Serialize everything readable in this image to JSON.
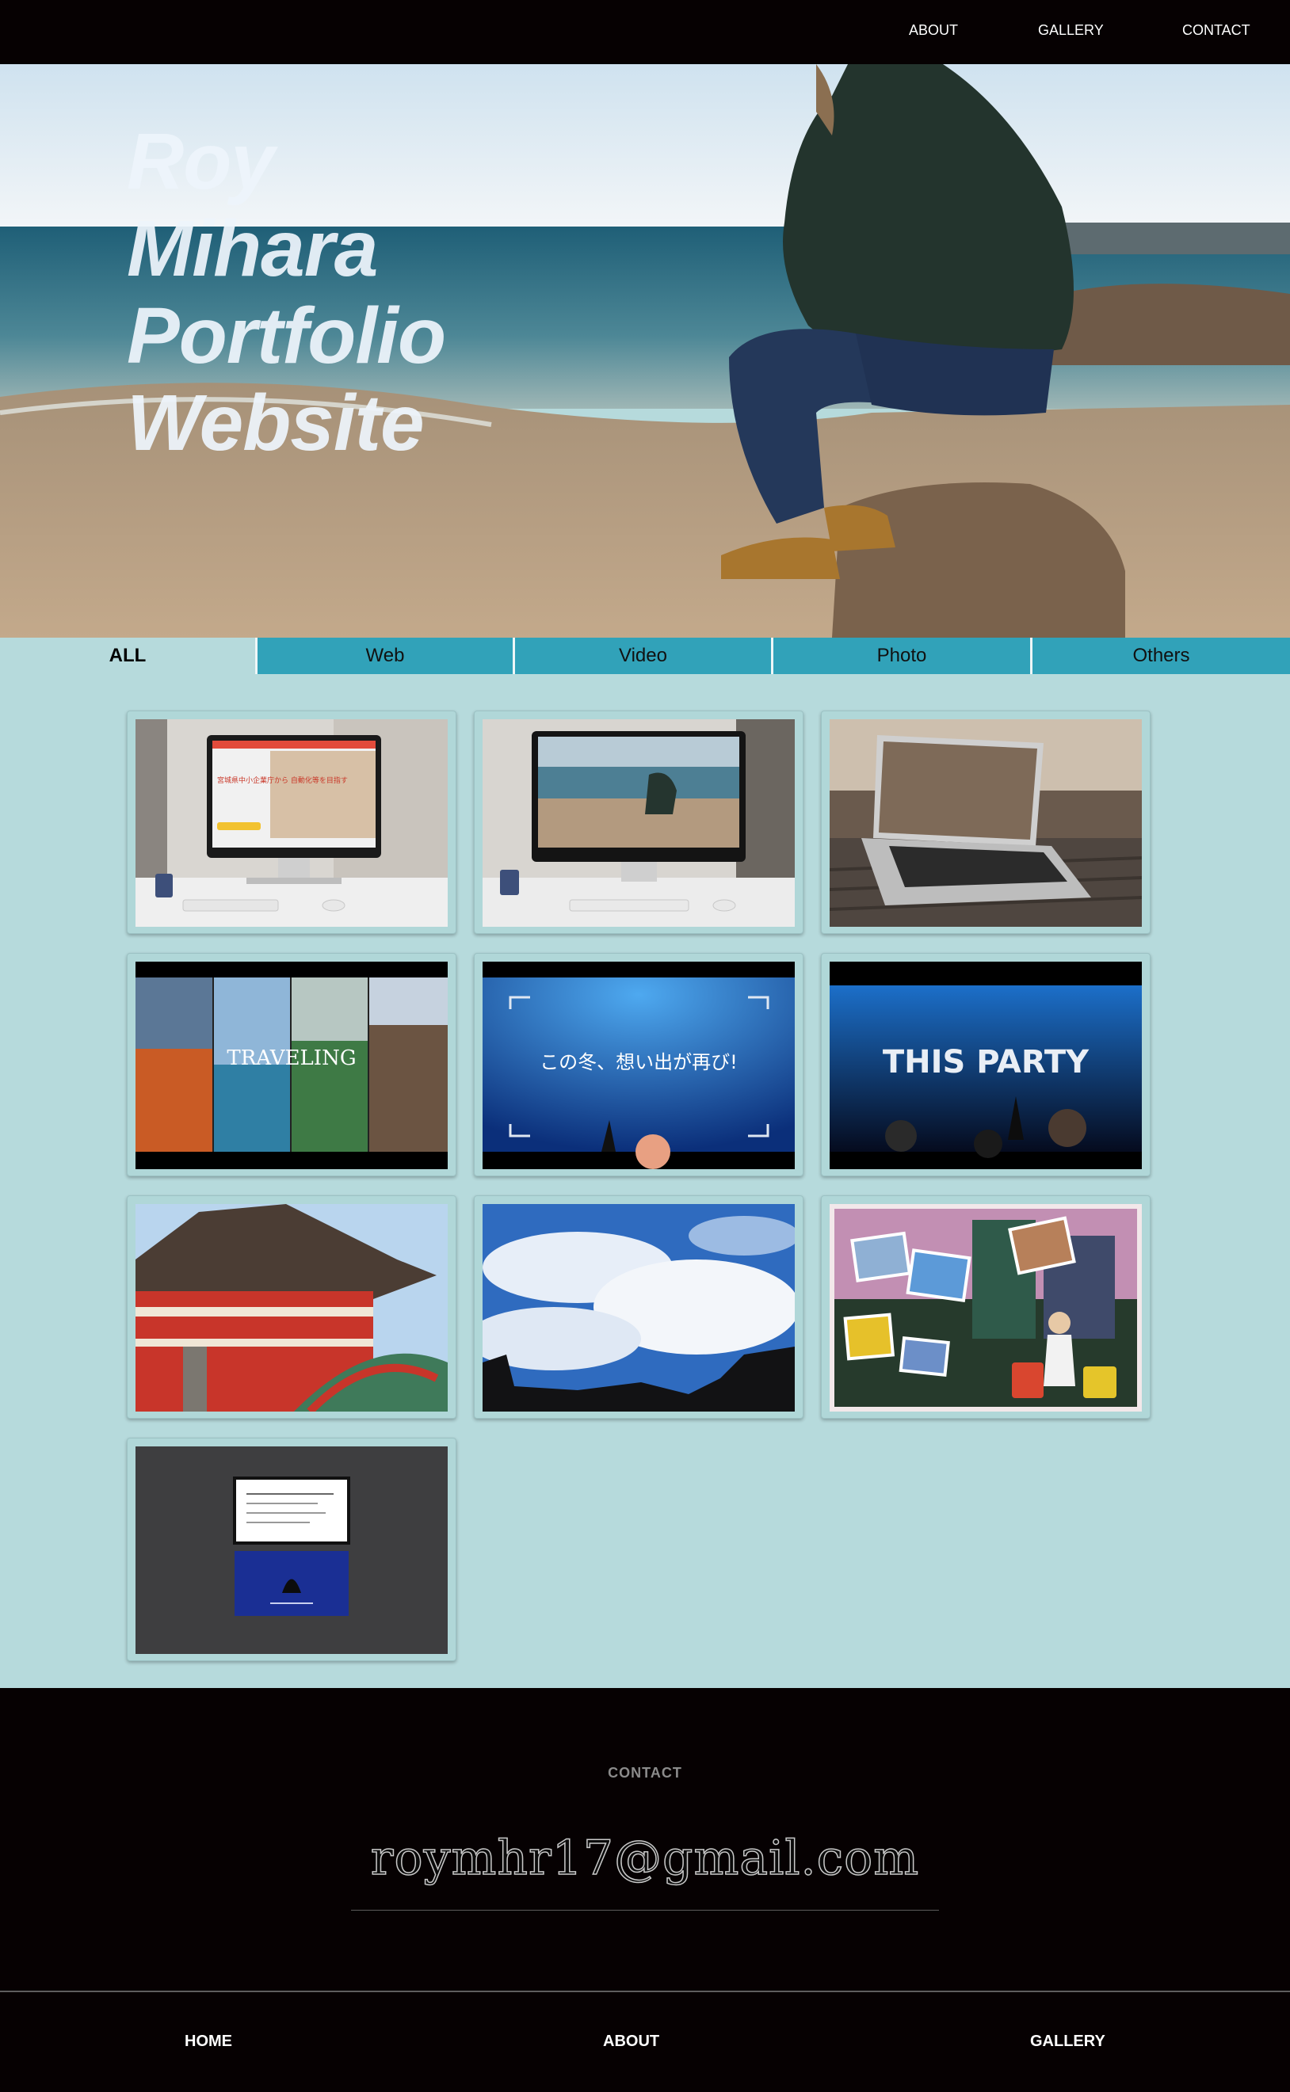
{
  "nav": {
    "about": "ABOUT",
    "gallery": "GALLERY",
    "contact": "CONTACT"
  },
  "hero": {
    "title_lines": [
      "Roy",
      "Mihara",
      "Portfolio",
      "Website"
    ]
  },
  "tabs": [
    {
      "label": "ALL",
      "active": true
    },
    {
      "label": "Web",
      "active": false
    },
    {
      "label": "Video",
      "active": false
    },
    {
      "label": "Photo",
      "active": false
    },
    {
      "label": "Others",
      "active": false
    }
  ],
  "gallery": {
    "items": [
      {
        "icon": "desktop-mockup-website-thumbnail",
        "overlay_text": "宮城県中小企業庁から 自動化等を目指す"
      },
      {
        "icon": "desktop-mockup-beach-thumbnail",
        "overlay_text": ""
      },
      {
        "icon": "laptop-cafe-thumbnail",
        "overlay_text": ""
      },
      {
        "icon": "traveling-video-thumbnail",
        "overlay_text": "TRAVELING"
      },
      {
        "icon": "winter-video-thumbnail",
        "overlay_text": "この冬、想い出が再び!"
      },
      {
        "icon": "party-video-thumbnail",
        "overlay_text": "THIS PARTY"
      },
      {
        "icon": "shrine-photo-thumbnail",
        "overlay_text": ""
      },
      {
        "icon": "sky-photo-thumbnail",
        "overlay_text": ""
      },
      {
        "icon": "collage-photo-thumbnail",
        "overlay_text": ""
      },
      {
        "icon": "business-card-thumbnail",
        "overlay_text": ""
      }
    ]
  },
  "contact": {
    "heading": "CONTACT",
    "email": "roymhr17@gmail.com"
  },
  "footer": {
    "home": "HOME",
    "about": "ABOUT",
    "gallery": "GALLERY"
  },
  "colors": {
    "nav_bg": "#060102",
    "tab_bg": "#31a2b9",
    "gallery_bg": "#b6dadc"
  }
}
